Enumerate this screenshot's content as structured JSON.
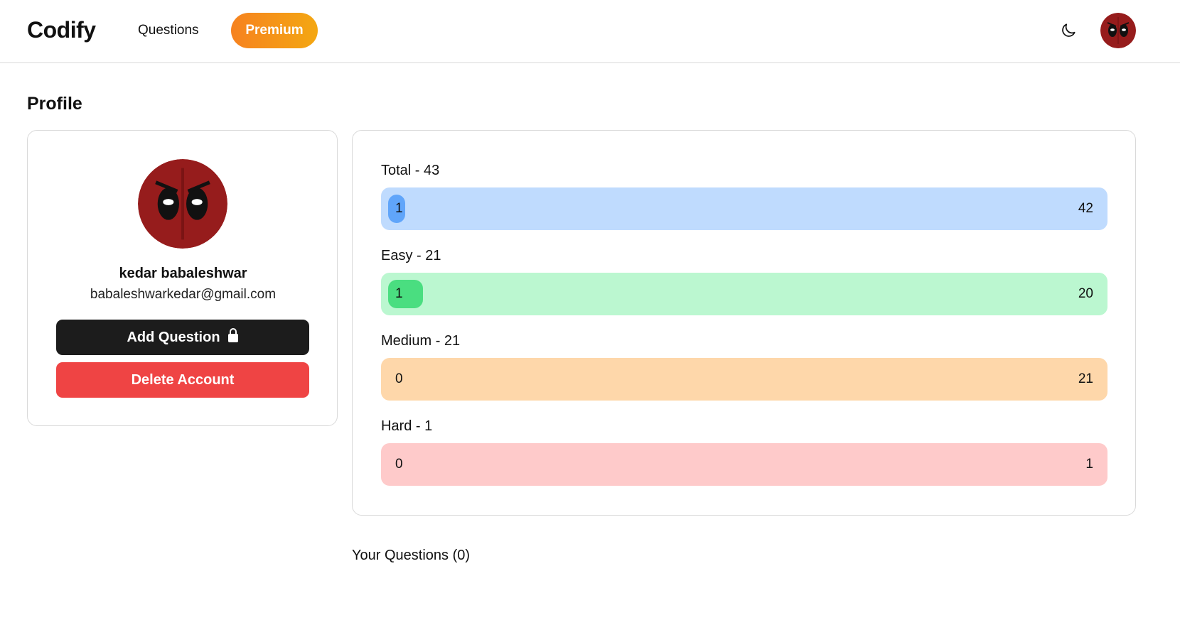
{
  "navbar": {
    "brand": "Codify",
    "questions_label": "Questions",
    "premium_label": "Premium"
  },
  "profile": {
    "title": "Profile",
    "name": "kedar babaleshwar",
    "email": "babaleshwarkedar@gmail.com",
    "add_question_label": "Add Question",
    "delete_account_label": "Delete Account"
  },
  "stats": {
    "total": {
      "label": "Total - 43",
      "solved": "1",
      "remaining": "42",
      "bar_color": "#bfdbfe",
      "pill_color": "#60a5fa"
    },
    "easy": {
      "label": "Easy - 21",
      "solved": "1",
      "remaining": "20",
      "bar_color": "#bbf7d0",
      "pill_color": "#4ade80"
    },
    "medium": {
      "label": "Medium - 21",
      "solved": "0",
      "remaining": "21",
      "bar_color": "#fed7aa",
      "pill_color": "#fb923c"
    },
    "hard": {
      "label": "Hard - 1",
      "solved": "0",
      "remaining": "1",
      "bar_color": "#fecaca",
      "pill_color": "#f87171"
    }
  },
  "your_questions": "Your Questions (0)",
  "icons": {
    "theme": "moon-icon",
    "lock": "lock-icon",
    "avatar": "deadpool-mask-avatar"
  },
  "colors": {
    "premium_gradient_start": "#f6821f",
    "premium_gradient_end": "#f4a712",
    "add_question_bg": "#1c1c1c",
    "delete_account_bg": "#ef4444"
  }
}
